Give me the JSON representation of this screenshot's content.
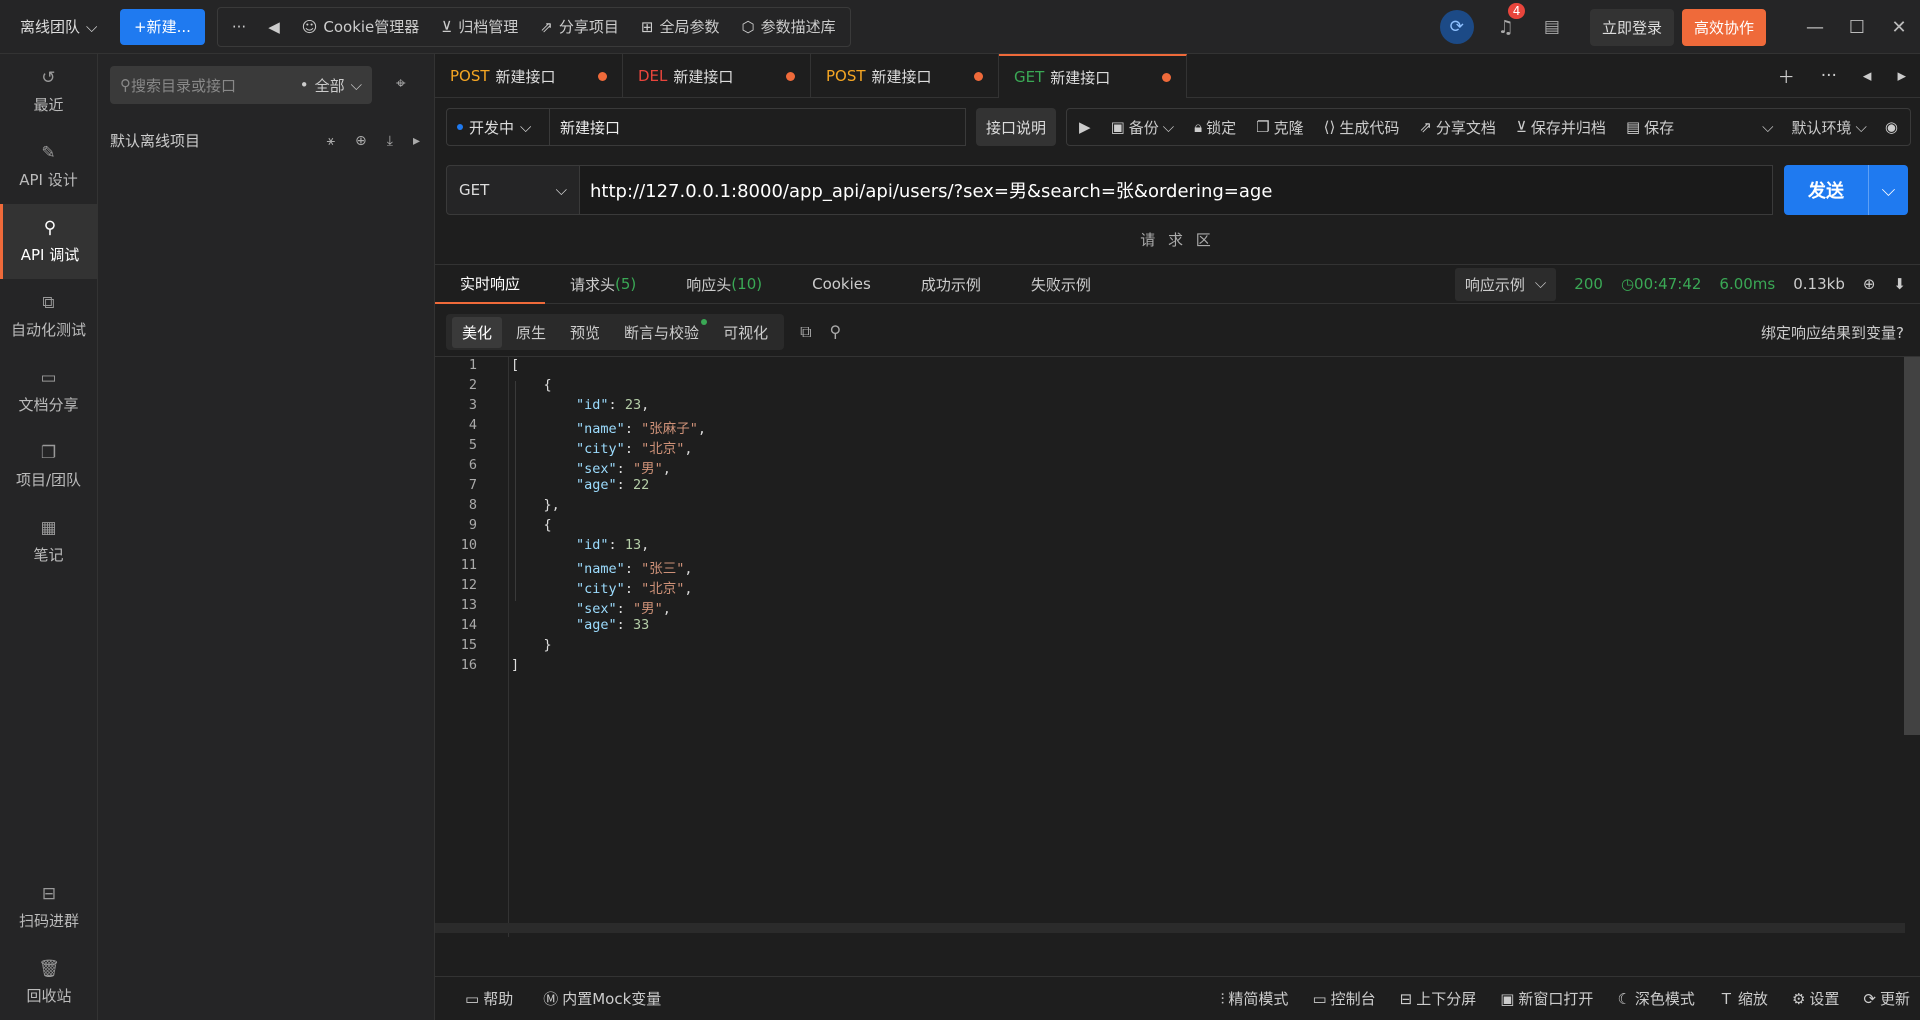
{
  "topbar": {
    "team": "离线团队",
    "new_btn": "+新建...",
    "more": "···",
    "tools": [
      "Cookie管理器",
      "归档管理",
      "分享项目",
      "全局参数",
      "参数描述库"
    ],
    "notif_count": "4",
    "login": "立即登录",
    "collab": "高效协作"
  },
  "sidebar": {
    "items": [
      "最近",
      "API 设计",
      "API 调试",
      "自动化测试",
      "文档分享",
      "项目/团队",
      "笔记"
    ],
    "bottom": [
      "扫码进群",
      "回收站"
    ]
  },
  "tree": {
    "search_placeholder": "搜索目录或接口",
    "filter": "全部",
    "project": "默认离线项目"
  },
  "tabs": [
    {
      "method": "POST",
      "name": "新建接口",
      "color": "#f5a623"
    },
    {
      "method": "DEL",
      "name": "新建接口",
      "color": "#e8453c"
    },
    {
      "method": "POST",
      "name": "新建接口",
      "color": "#f5a623"
    },
    {
      "method": "GET",
      "name": "新建接口",
      "color": "#3aa855"
    }
  ],
  "request": {
    "status": "开发中",
    "name": "新建接口",
    "desc_btn": "接口说明",
    "actions": [
      "备份",
      "锁定",
      "克隆",
      "生成代码",
      "分享文档",
      "保存并归档",
      "保存"
    ],
    "env": "默认环境",
    "method": "GET",
    "url": "http://127.0.0.1:8000/app_api/api/users/?sex=男&search=张&ordering=age",
    "send": "发送",
    "area_label": "请 求 区"
  },
  "response": {
    "tabs": [
      {
        "label": "实时响应",
        "count": ""
      },
      {
        "label": "请求头",
        "count": "(5)"
      },
      {
        "label": "响应头",
        "count": "(10)"
      },
      {
        "label": "Cookies",
        "count": ""
      },
      {
        "label": "成功示例",
        "count": ""
      },
      {
        "label": "失败示例",
        "count": ""
      }
    ],
    "example_select": "响应示例",
    "code": "200",
    "time": "00:47:42",
    "duration": "6.00ms",
    "size": "0.13kb",
    "views": [
      "美化",
      "原生",
      "预览",
      "断言与校验",
      "可视化"
    ],
    "bind_var": "绑定响应结果到变量?",
    "lines": [
      "1",
      "2",
      "3",
      "4",
      "5",
      "6",
      "7",
      "8",
      "9",
      "10",
      "11",
      "12",
      "13",
      "14",
      "15",
      "16"
    ]
  },
  "json_items": [
    {
      "id": "23",
      "name": "\"张麻子\"",
      "city": "\"北京\"",
      "sex": "\"男\"",
      "age": "22"
    },
    {
      "id": "13",
      "name": "\"张三\"",
      "city": "\"北京\"",
      "sex": "\"男\"",
      "age": "33"
    }
  ],
  "footer": {
    "left": [
      "帮助",
      "内置Mock变量"
    ],
    "right": [
      "精简模式",
      "控制台",
      "上下分屏",
      "新窗口打开",
      "深色模式",
      "缩放",
      "设置",
      "更新"
    ]
  }
}
